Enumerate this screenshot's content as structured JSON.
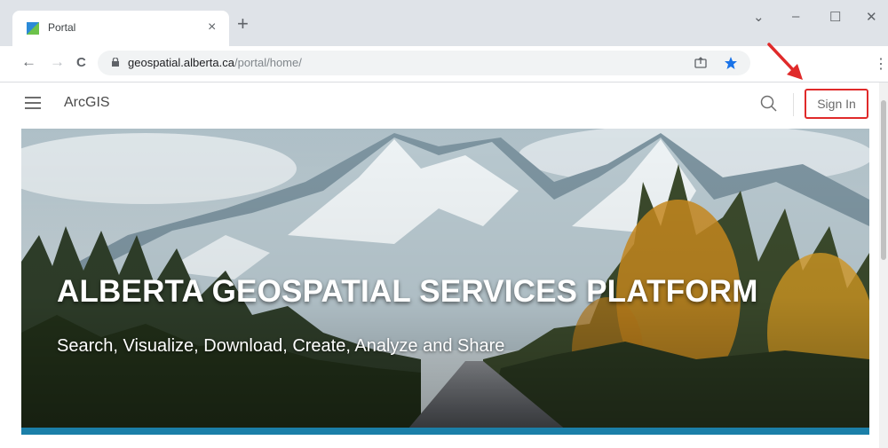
{
  "browser": {
    "tab_title": "Portal",
    "new_tab_label": "+",
    "close_tab_label": "×",
    "url_host": "geospatial.alberta.ca",
    "url_path": "/portal/home/",
    "window_controls": {
      "dropdown": "⌄",
      "minimize": "–",
      "maximize": "☐",
      "close": "✕"
    },
    "menu_label": "⋮",
    "nav": {
      "back": "←",
      "forward": "→",
      "reload": "C"
    }
  },
  "header": {
    "brand": "ArcGIS",
    "signin_label": "Sign In"
  },
  "hero": {
    "title": "ALBERTA GEOSPATIAL SERVICES PLATFORM",
    "subtitle": "Search, Visualize, Download, Create, Analyze and Share"
  },
  "colors": {
    "accent": "#1b7fa8",
    "signin_border": "#e02a2a",
    "annotation_arrow": "#e02a2a"
  },
  "icons": [
    "menu-icon",
    "search-icon",
    "lock-icon",
    "share-icon",
    "star-icon",
    "annotation-arrow"
  ]
}
